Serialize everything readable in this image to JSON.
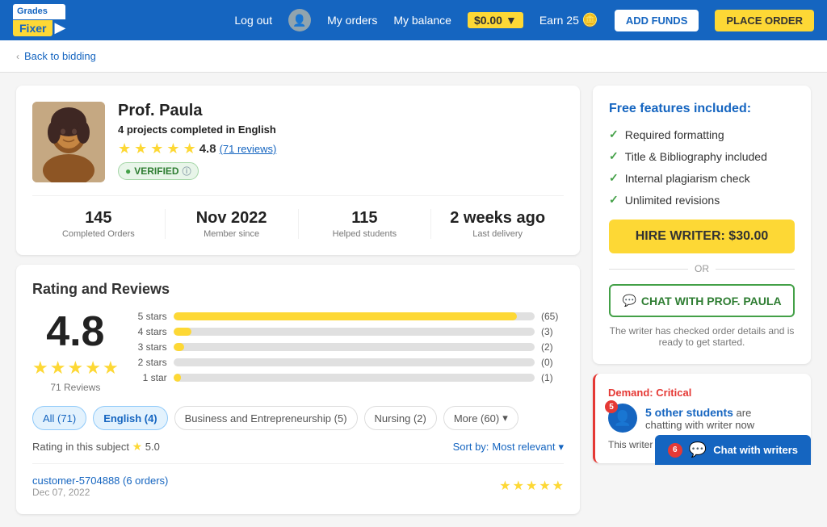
{
  "header": {
    "logo_top": "Grades",
    "logo_bottom": "Fixer",
    "logout": "Log out",
    "my_orders": "My orders",
    "my_balance_label": "My balance",
    "balance_value": "$0.00",
    "earn_label": "Earn 25",
    "add_funds": "ADD FUNDS",
    "place_order": "PLACE ORDER"
  },
  "breadcrumb": {
    "back": "Back to bidding"
  },
  "profile": {
    "name": "Prof. Paula",
    "projects_text": "4 projects completed in",
    "language": "English",
    "rating": "4.8",
    "reviews": "(71 reviews)",
    "verified": "VERIFIED",
    "stats": [
      {
        "num": "145",
        "label": "Completed Orders"
      },
      {
        "num": "Nov 2022",
        "label": "Member since"
      },
      {
        "num": "115",
        "label": "Helped students"
      },
      {
        "num": "2 weeks ago",
        "label": "Last delivery"
      }
    ]
  },
  "reviews_section": {
    "title": "Rating and Reviews",
    "big_rating": "4.8",
    "total_reviews": "71 Reviews",
    "bars": [
      {
        "label": "5 stars",
        "percent": 95,
        "count": "(65)"
      },
      {
        "label": "4 stars",
        "percent": 5,
        "count": "(3)"
      },
      {
        "label": "3 stars",
        "percent": 3,
        "count": "(2)"
      },
      {
        "label": "2 stars",
        "percent": 0,
        "count": "(0)"
      },
      {
        "label": "1 star",
        "percent": 2,
        "count": "(1)"
      }
    ],
    "filter_tabs": [
      {
        "label": "All (71)",
        "active": true
      },
      {
        "label": "English (4)",
        "active": false
      },
      {
        "label": "Business and Entrepreneurship (5)",
        "active": false
      },
      {
        "label": "Nursing (2)",
        "active": false
      },
      {
        "label": "More (60)",
        "active": false
      }
    ],
    "rating_subject_prefix": "Rating in this subject",
    "rating_subject_value": "5.0",
    "sort_by": "Sort by:",
    "sort_value": "Most relevant",
    "review": {
      "customer": "customer-5704888 (6 orders)",
      "date": "Dec 07, 2022"
    }
  },
  "free_features": {
    "title": "Free features included:",
    "items": [
      "Required formatting",
      "Title & Bibliography included",
      "Internal plagiarism check",
      "Unlimited revisions"
    ],
    "hire_btn": "HIRE WRITER: $30.00",
    "or": "OR",
    "chat_btn": "CHAT WITH PROF. PAULA",
    "chat_note": "The writer has checked order details and is ready to get started."
  },
  "demand": {
    "label": "Demand:",
    "status": "Critical",
    "badge_count": "5",
    "students_count": "5 other students",
    "students_text": "are chatting with writer now",
    "may_not": "This writer may no..."
  },
  "chat_float": {
    "badge": "6",
    "label": "Chat with writers"
  }
}
